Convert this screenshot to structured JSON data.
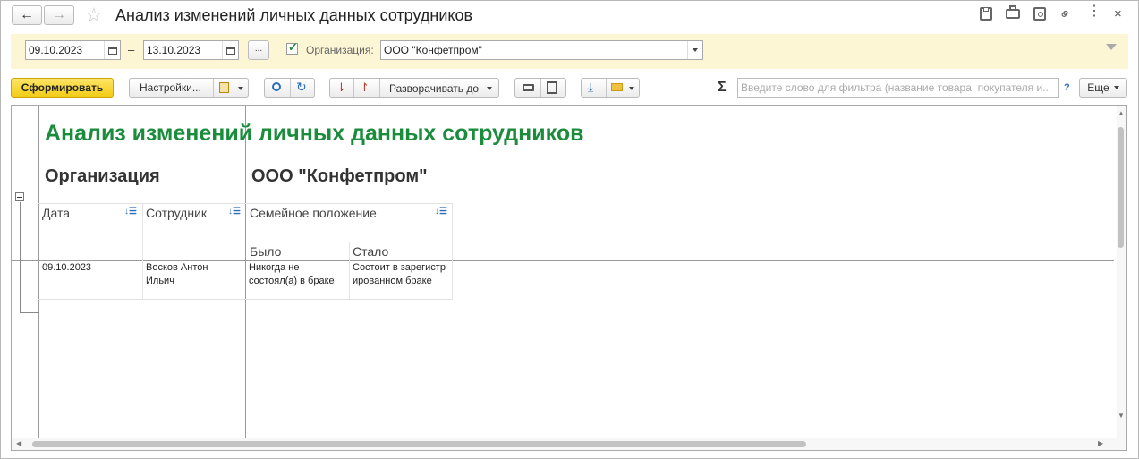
{
  "window": {
    "title": "Анализ изменений личных данных сотрудников"
  },
  "period": {
    "date_from": "09.10.2023",
    "dash": "–",
    "date_to": "13.10.2023",
    "more": "..."
  },
  "organization": {
    "label": "Организация:",
    "value": "ООО \"Конфетпром\""
  },
  "toolbar": {
    "generate": "Сформировать",
    "settings": "Настройки...",
    "expand": "Разворачивать до",
    "more": "Еще",
    "sigma": "Σ",
    "help": "?",
    "search_placeholder": "Введите слово для фильтра (название товара, покупателя и..."
  },
  "report": {
    "title": "Анализ изменений личных данных сотрудников",
    "org_label": "Организация",
    "org_value": "ООО \"Конфетпром\"",
    "collapse": "−",
    "columns": {
      "date": "Дата",
      "employee": "Сотрудник",
      "marital": "Семейное положение",
      "was": "Было",
      "became": "Стало"
    },
    "rows": [
      {
        "date": "09.10.2023",
        "employee": "Восков Антон Ильич",
        "was": "Никогда не состоял(а) в браке",
        "became": "Состоит в зарегистрированном браке"
      }
    ]
  },
  "colors": {
    "accent_green": "#1a8c3c",
    "generate_btn": "#f5d327",
    "filter_bar": "#fcf6d4"
  }
}
